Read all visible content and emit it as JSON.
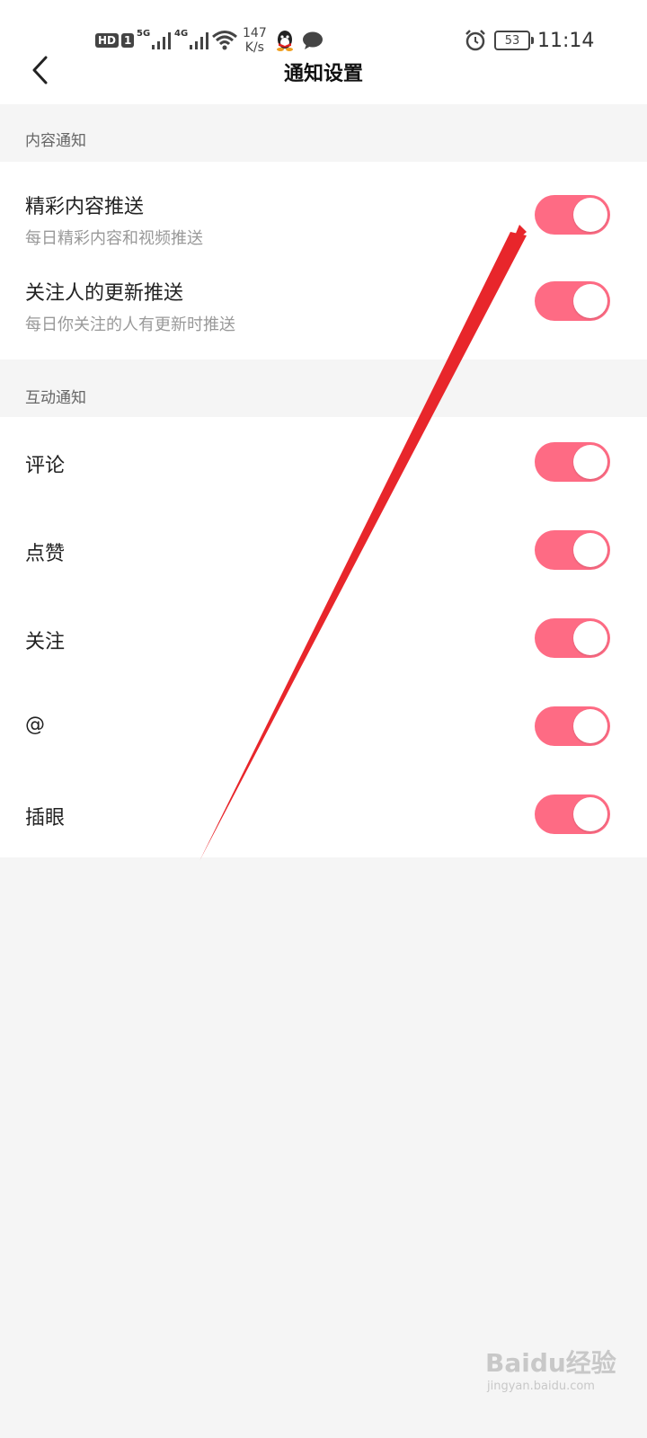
{
  "status_bar": {
    "hd_badge": "HD",
    "sim_badge": "1",
    "signal1_tag": "5G",
    "signal2_tag": "4G",
    "net_speed_value": "147",
    "net_speed_unit": "K/s",
    "battery": "53",
    "time": "11:14"
  },
  "header": {
    "title": "通知设置"
  },
  "sections": [
    {
      "header": "内容通知",
      "items": [
        {
          "title": "精彩内容推送",
          "subtitle": "每日精彩内容和视频推送",
          "on": true
        },
        {
          "title": "关注人的更新推送",
          "subtitle": "每日你关注的人有更新时推送",
          "on": true
        }
      ]
    },
    {
      "header": "互动通知",
      "items": [
        {
          "title": "评论",
          "on": true
        },
        {
          "title": "点赞",
          "on": true
        },
        {
          "title": "关注",
          "on": true
        },
        {
          "title": "@",
          "on": true
        },
        {
          "title": "插眼",
          "on": true
        }
      ]
    }
  ],
  "colors": {
    "toggle_on": "#fe6b84",
    "annotation_arrow": "#e8262b"
  },
  "watermark": {
    "main": "Baidu经验",
    "sub": "jingyan.baidu.com"
  }
}
